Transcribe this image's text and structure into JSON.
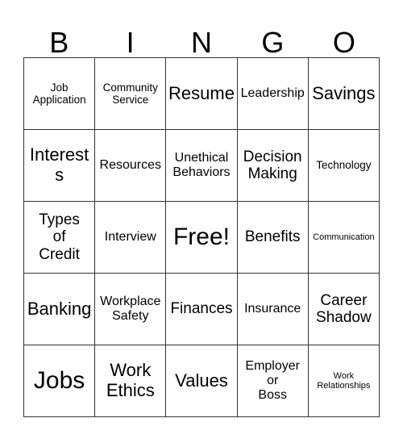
{
  "card": {
    "title_letters": [
      "B",
      "I",
      "N",
      "G",
      "O"
    ],
    "colors": {
      "border": "#333333",
      "cell_background": "#ffffff",
      "text": "#000000",
      "page_background": "#ffffff"
    },
    "rows": [
      [
        {
          "label": "Job\nApplication",
          "size": "fs-s"
        },
        {
          "label": "Community\nService",
          "size": "fs-s"
        },
        {
          "label": "Resume",
          "size": "fs-xl"
        },
        {
          "label": "Leadership",
          "size": "fs-m"
        },
        {
          "label": "Savings",
          "size": "fs-xl"
        }
      ],
      [
        {
          "label": "Interests",
          "size": "fs-xl"
        },
        {
          "label": "Resources",
          "size": "fs-m"
        },
        {
          "label": "Unethical\nBehaviors",
          "size": "fs-m"
        },
        {
          "label": "Decision\nMaking",
          "size": "fs-l"
        },
        {
          "label": "Technology",
          "size": "fs-s"
        }
      ],
      [
        {
          "label": "Types\nof\nCredit",
          "size": "fs-l"
        },
        {
          "label": "Interview",
          "size": "fs-m"
        },
        {
          "label": "Free!",
          "size": "fs-xxl"
        },
        {
          "label": "Benefits",
          "size": "fs-l"
        },
        {
          "label": "Communication",
          "size": "fs-xs"
        }
      ],
      [
        {
          "label": "Banking",
          "size": "fs-xl"
        },
        {
          "label": "Workplace\nSafety",
          "size": "fs-m"
        },
        {
          "label": "Finances",
          "size": "fs-l"
        },
        {
          "label": "Insurance",
          "size": "fs-m"
        },
        {
          "label": "Career\nShadow",
          "size": "fs-l"
        }
      ],
      [
        {
          "label": "Jobs",
          "size": "fs-xxl"
        },
        {
          "label": "Work\nEthics",
          "size": "fs-xl"
        },
        {
          "label": "Values",
          "size": "fs-xl"
        },
        {
          "label": "Employer\nor\nBoss",
          "size": "fs-m"
        },
        {
          "label": "Work\nRelationships",
          "size": "fs-xs"
        }
      ]
    ]
  }
}
